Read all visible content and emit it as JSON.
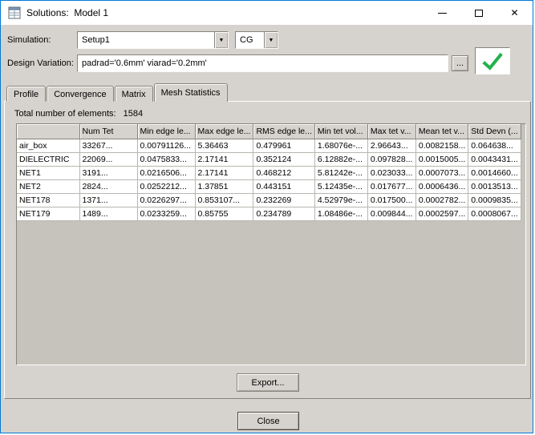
{
  "window": {
    "title": "Solutions:  Model 1"
  },
  "icons": {
    "minimize_glyph": "—",
    "close_glyph": "✕",
    "dropdown_arrow": "▼"
  },
  "colors": {
    "window_border": "#0078d7",
    "check_green": "#22b14c"
  },
  "toolbar": {
    "simulation_label": "Simulation:",
    "simulation_value": "Setup1",
    "matrix_type_value": "CG",
    "design_variation_label": "Design Variation:",
    "design_variation_value": "padrad='0.6mm' viarad='0.2mm'",
    "browse_label": "..."
  },
  "tabs": [
    {
      "label": "Profile",
      "active": false
    },
    {
      "label": "Convergence",
      "active": false
    },
    {
      "label": "Matrix",
      "active": false
    },
    {
      "label": "Mesh Statistics",
      "active": true
    }
  ],
  "panel": {
    "total_label": "Total number of elements:",
    "total_value": "1584"
  },
  "table": {
    "columns": [
      "",
      "Num Tet",
      "Min edge le...",
      "Max edge le...",
      "RMS edge le...",
      "Min tet vol...",
      "Max tet v...",
      "Mean tet v...",
      "Std Devn (..."
    ],
    "rows": [
      {
        "name": "air_box",
        "values": [
          "33267...",
          "0.00791126...",
          "5.36463",
          "0.479961",
          "1.68076e-...",
          "2.96643...",
          "0.0082158...",
          "0.064638..."
        ]
      },
      {
        "name": "DIELECTRIC",
        "values": [
          "22069...",
          "0.0475833...",
          "2.17141",
          "0.352124",
          "6.12882e-...",
          "0.097828...",
          "0.0015005...",
          "0.0043431..."
        ]
      },
      {
        "name": "NET1",
        "values": [
          "3191...",
          "0.0216506...",
          "2.17141",
          "0.468212",
          "5.81242e-...",
          "0.023033...",
          "0.0007073...",
          "0.0014660..."
        ]
      },
      {
        "name": "NET2",
        "values": [
          "2824...",
          "0.0252212...",
          "1.37851",
          "0.443151",
          "5.12435e-...",
          "0.017677...",
          "0.0006436...",
          "0.0013513..."
        ]
      },
      {
        "name": "NET178",
        "values": [
          "1371...",
          "0.0226297...",
          "0.853107...",
          "0.232269",
          "4.52979e-...",
          "0.017500...",
          "0.0002782...",
          "0.0009835..."
        ]
      },
      {
        "name": "NET179",
        "values": [
          "1489...",
          "0.0233259...",
          "0.85755",
          "0.234789",
          "1.08486e-...",
          "0.009844...",
          "0.0002597...",
          "0.0008067..."
        ]
      }
    ]
  },
  "buttons": {
    "export": "Export...",
    "close": "Close"
  }
}
